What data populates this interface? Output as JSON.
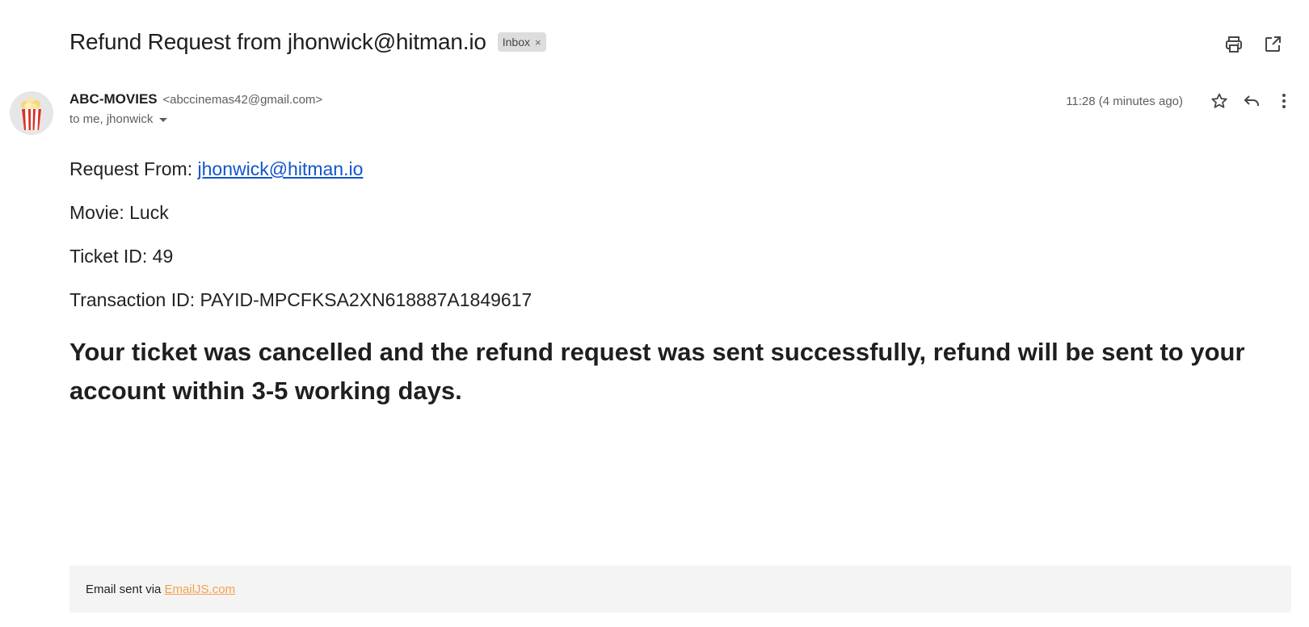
{
  "header": {
    "subject": "Refund Request from jhonwick@hitman.io",
    "label": "Inbox",
    "label_remove_glyph": "×",
    "print_icon": "printer-icon",
    "open_new_window_icon": "open-in-new-icon"
  },
  "sender": {
    "name": "ABC-MOVIES",
    "email": "<abccinemas42@gmail.com>",
    "recipients": "to me, jhonwick",
    "avatar_icon": "popcorn-icon"
  },
  "meta": {
    "timestamp": "11:28 (4 minutes ago)",
    "star_icon": "star-icon",
    "reply_icon": "reply-icon",
    "more_icon": "more-vert-icon"
  },
  "body": {
    "request_from_label": "Request From: ",
    "request_from_email": "jhonwick@hitman.io",
    "movie": "Movie: Luck",
    "ticket_id": "Ticket ID: 49",
    "transaction_id": "Transaction ID: PAYID-MPCFKSA2XN618887A1849617",
    "notice": "Your ticket was cancelled and the refund request was sent successfully, refund will be sent to your account within 3-5 working days."
  },
  "footer": {
    "prefix": "Email sent via ",
    "link": "EmailJS.com"
  },
  "colors": {
    "link": "#1155cc",
    "footer_link": "#f5a04b",
    "footer_bg": "#f4f4f4",
    "chip_bg": "#dddddd",
    "popcorn_red": "#d93025"
  }
}
